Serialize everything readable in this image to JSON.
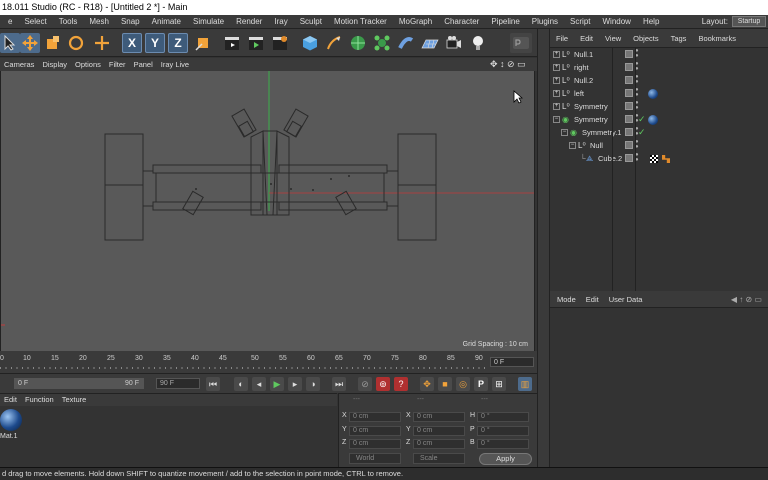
{
  "titlebar": {
    "text": "18.011 Studio (RC - R18) - [Untitled 2 *] - Main"
  },
  "menubar": {
    "items": [
      "e",
      "Select",
      "Tools",
      "Mesh",
      "Snap",
      "Animate",
      "Simulate",
      "Render",
      "Iray",
      "Sculpt",
      "Motion Tracker",
      "MoGraph",
      "Character",
      "Pipeline",
      "Plugins",
      "Script",
      "Window",
      "Help"
    ],
    "layout_label": "Layout:",
    "layout_value": "Startup"
  },
  "toolbar": {
    "axis_x": "X",
    "axis_y": "Y",
    "axis_z": "Z"
  },
  "viewport": {
    "menu": [
      "Cameras",
      "Display",
      "Options",
      "Filter",
      "Panel",
      "Iray Live"
    ],
    "grid_spacing": "Grid Spacing : 10 cm"
  },
  "timeline": {
    "ticks": [
      "0",
      "10",
      "15",
      "20",
      "25",
      "30",
      "35",
      "40",
      "45",
      "50",
      "55",
      "60",
      "65",
      "70",
      "75",
      "80",
      "85",
      "90"
    ],
    "current_frame": "0 F",
    "start_field": "0 F",
    "range_end": "90 F",
    "end_field": "90 F"
  },
  "materials": {
    "menu": [
      "Edit",
      "Function",
      "Texture"
    ],
    "material_name": "Mat.1"
  },
  "coordinates": {
    "dashes": [
      "---",
      "---",
      "---"
    ],
    "rows": [
      {
        "pos_label": "X",
        "pos": "0 cm",
        "size_label": "X",
        "size": "0 cm",
        "rot_label": "H",
        "rot": "0 °"
      },
      {
        "pos_label": "Y",
        "pos": "0 cm",
        "size_label": "Y",
        "size": "0 cm",
        "rot_label": "P",
        "rot": "0 °"
      },
      {
        "pos_label": "Z",
        "pos": "0 cm",
        "size_label": "Z",
        "size": "0 cm",
        "rot_label": "B",
        "rot": "0 °"
      }
    ],
    "mode_world": "World",
    "mode_scale": "Scale",
    "apply": "Apply"
  },
  "objects": {
    "menu": [
      "File",
      "Edit",
      "View",
      "Objects",
      "Tags",
      "Bookmarks"
    ],
    "rows": [
      {
        "label": "Null.1",
        "icon": "null-icon",
        "indent": 0,
        "expand": "+"
      },
      {
        "label": "right",
        "icon": "null-icon",
        "indent": 0,
        "expand": "+"
      },
      {
        "label": "Null.2",
        "icon": "null-icon",
        "indent": 0,
        "expand": "+"
      },
      {
        "label": "left",
        "icon": "null-icon",
        "indent": 0,
        "expand": "+",
        "material": true
      },
      {
        "label": "Symmetry",
        "icon": "null-icon",
        "indent": 0,
        "expand": "+"
      },
      {
        "label": "Symmetry",
        "icon": "symmetry-icon",
        "indent": 0,
        "expand": "−",
        "material": true,
        "check": true
      },
      {
        "label": "Symmetry.1",
        "icon": "symmetry-icon",
        "indent": 1,
        "expand": "−",
        "check": true
      },
      {
        "label": "Null",
        "icon": "null-icon",
        "indent": 2,
        "expand": "−"
      },
      {
        "label": "Cube.2",
        "icon": "cube-icon",
        "indent": 3,
        "expand": "",
        "tags": true
      }
    ]
  },
  "attributes": {
    "menu": [
      "Mode",
      "Edit",
      "User Data"
    ]
  },
  "statusbar": {
    "text": "d drag to move elements. Hold down SHIFT to quantize movement / add to the selection in point mode, CTRL to remove."
  },
  "colors": {
    "viewport_bg": "#595959",
    "panel_bg": "#333333",
    "toolbar_bg": "#3a3a3a",
    "axis_red": "#c23a3a",
    "axis_green": "#3ab04a",
    "selection_blue": "#4d6b8c"
  }
}
